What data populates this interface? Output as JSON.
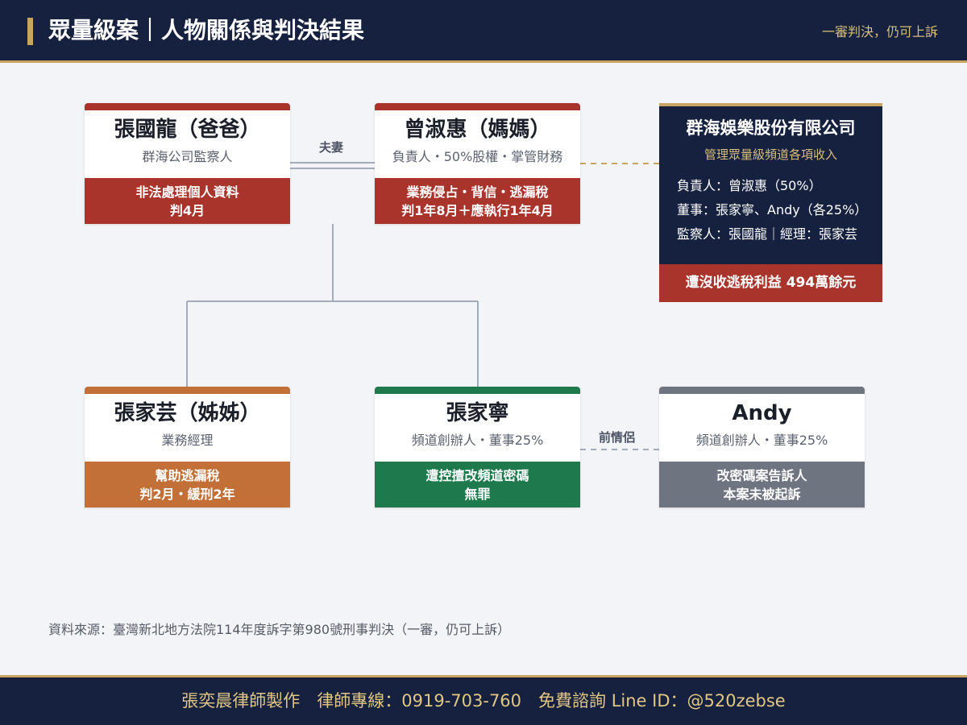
{
  "header": {
    "title": "眾量級案｜人物關係與判決結果",
    "subtitle": "一審判決，仍可上訴"
  },
  "relations": {
    "spouse_label": "夫妻",
    "ex_partner_label": "前情侶"
  },
  "people": {
    "father": {
      "name": "張國龍（爸爸）",
      "role": "群海公司監察人",
      "verdict_line1": "非法處理個人資料",
      "verdict_line2": "判4月",
      "color": "#a9342b"
    },
    "mother": {
      "name": "曾淑惠（媽媽）",
      "role": "負責人・50%股權・掌管財務",
      "verdict_line1": "業務侵占・背信・逃漏稅",
      "verdict_line2": "判1年8月＋應執行1年4月",
      "color": "#a9342b"
    },
    "sister": {
      "name": "張家芸（姊姊）",
      "role": "業務經理",
      "verdict_line1": "幫助逃漏稅",
      "verdict_line2": "判2月・緩刑2年",
      "color": "#c26f38"
    },
    "son": {
      "name": "張家寧",
      "role": "頻道創辦人・董事25%",
      "verdict_line1": "遭控擅改頻道密碼",
      "verdict_line2": "無罪",
      "color": "#1e7a4c"
    },
    "andy": {
      "name": "Andy",
      "role": "頻道創辦人・董事25%",
      "verdict_line1": "改密碼案告訴人",
      "verdict_line2": "本案未被起訴",
      "color": "#6e7480"
    }
  },
  "company": {
    "name": "群海娛樂股份有限公司",
    "description": "管理眾量級頻道各項收入",
    "details": [
      "負責人：曾淑惠（50%）",
      "董事：張家寧、Andy（各25%）",
      "監察人：張國龍｜經理：張家芸"
    ],
    "result": "遭沒收逃稅利益 494萬餘元",
    "color": "#15213f"
  },
  "source": "資料來源：臺灣新北地方法院114年度訴字第980號刑事判決（一審，仍可上訴）",
  "footer": {
    "credit": "張奕晨律師製作　律師專線：0919-703-760　免費諮詢 Line ID：@520zebse"
  }
}
